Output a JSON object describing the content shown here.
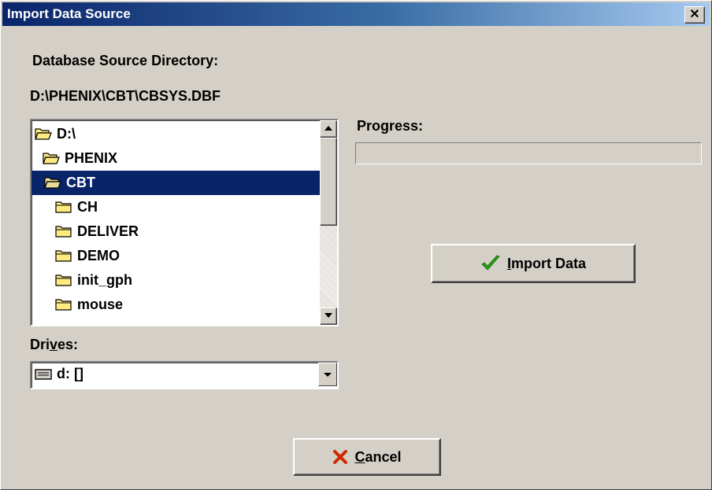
{
  "window": {
    "title": "Import Data Source",
    "close_glyph": "✕"
  },
  "labels": {
    "source_dir": "Database Source Directory:",
    "source_path": "D:\\PHENIX\\CBT\\CBSYS.DBF",
    "progress": "Progress:",
    "drives_pre": "Dri",
    "drives_mnemonic": "v",
    "drives_post": "es:"
  },
  "directory_list": {
    "items": [
      {
        "label": "D:\\",
        "icon": "open-folder-icon",
        "indent": 0
      },
      {
        "label": "PHENIX",
        "icon": "open-folder-icon",
        "indent": 1
      },
      {
        "label": "CBT",
        "icon": "open-folder-icon",
        "indent": 2,
        "selected": true
      },
      {
        "label": "CH",
        "icon": "folder-icon",
        "indent": 3
      },
      {
        "label": "DELIVER",
        "icon": "folder-icon",
        "indent": 3
      },
      {
        "label": "DEMO",
        "icon": "folder-icon",
        "indent": 3
      },
      {
        "label": "init_gph",
        "icon": "folder-icon",
        "indent": 3
      },
      {
        "label": "mouse",
        "icon": "folder-icon",
        "indent": 3
      }
    ]
  },
  "drives": {
    "selected": "d: []",
    "icon": "drive-icon"
  },
  "progress": {
    "value": 0
  },
  "buttons": {
    "import_mnemonic": "I",
    "import_rest": "mport Data",
    "cancel_mnemonic": "C",
    "cancel_rest": "ancel"
  },
  "colors": {
    "face": "#d4d0c8",
    "selection": "#0a246a",
    "checkmark": "#2a9d12",
    "cross": "#d02800",
    "folder": "#ffea80"
  }
}
